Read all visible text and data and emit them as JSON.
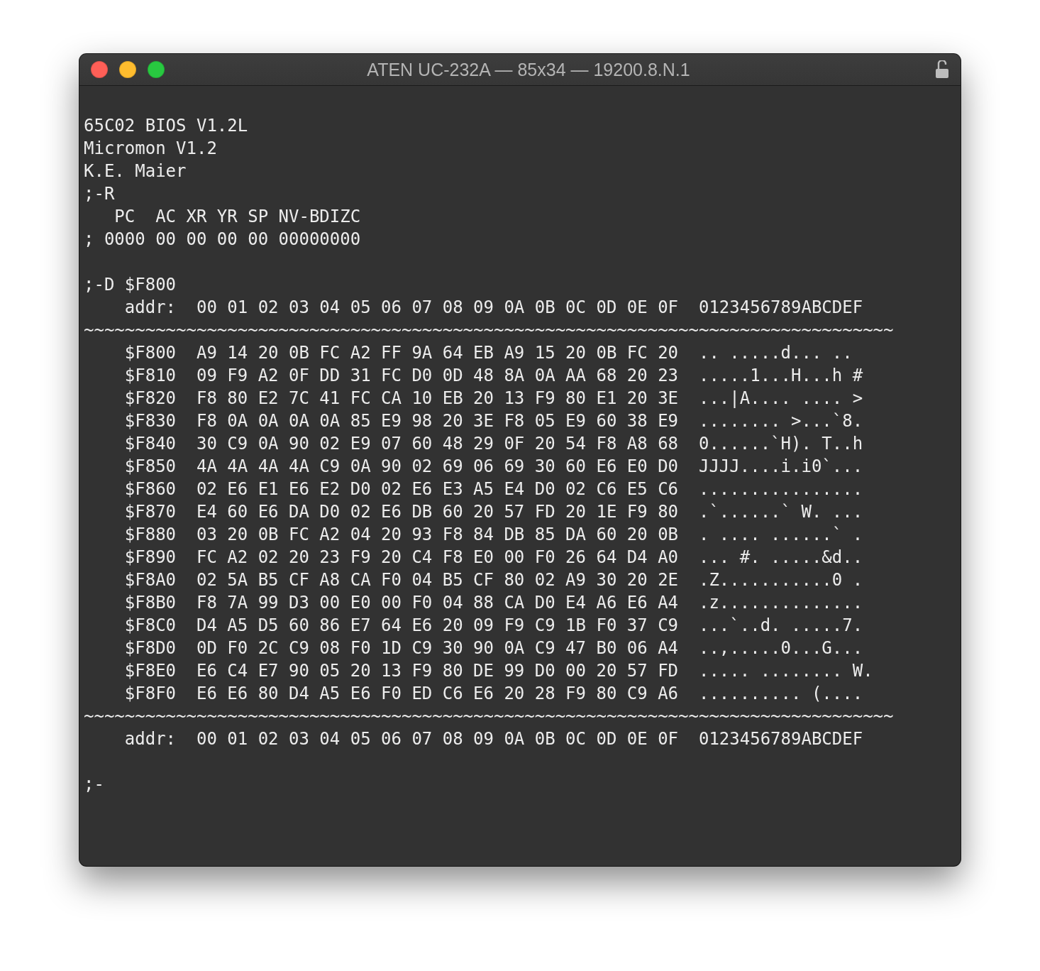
{
  "window": {
    "title": "ATEN UC-232A — 85x34 — 19200.8.N.1",
    "locked": false
  },
  "terminal": {
    "blocks": [
      [
        "65C02 BIOS V1.2L",
        "Micromon V1.2",
        "K.E. Maier",
        ";-R",
        "   PC  AC XR YR SP NV-BDIZC",
        "; 0000 00 00 00 00 00000000"
      ],
      [
        ";-D $F800",
        "    addr:  00 01 02 03 04 05 06 07 08 09 0A 0B 0C 0D 0E 0F  0123456789ABCDEF",
        "~~~~~~~~~~~~~~~~~~~~~~~~~~~~~~~~~~~~~~~~~~~~~~~~~~~~~~~~~~~~~~~~~~~~~~~~~~~~~~~",
        "    $F800  A9 14 20 0B FC A2 FF 9A 64 EB A9 15 20 0B FC 20  .. .....d... ..",
        "    $F810  09 F9 A2 0F DD 31 FC D0 0D 48 8A 0A AA 68 20 23  .....1...H...h #",
        "    $F820  F8 80 E2 7C 41 FC CA 10 EB 20 13 F9 80 E1 20 3E  ...|A.... .... >",
        "    $F830  F8 0A 0A 0A 0A 85 E9 98 20 3E F8 05 E9 60 38 E9  ........ >...`8.",
        "    $F840  30 C9 0A 90 02 E9 07 60 48 29 0F 20 54 F8 A8 68  0......`H). T..h",
        "    $F850  4A 4A 4A 4A C9 0A 90 02 69 06 69 30 60 E6 E0 D0  JJJJ....i.i0`...",
        "    $F860  02 E6 E1 E6 E2 D0 02 E6 E3 A5 E4 D0 02 C6 E5 C6  ................",
        "    $F870  E4 60 E6 DA D0 02 E6 DB 60 20 57 FD 20 1E F9 80  .`......` W. ...",
        "    $F880  03 20 0B FC A2 04 20 93 F8 84 DB 85 DA 60 20 0B  . .... ......` .",
        "    $F890  FC A2 02 20 23 F9 20 C4 F8 E0 00 F0 26 64 D4 A0  ... #. .....&d..",
        "    $F8A0  02 5A B5 CF A8 CA F0 04 B5 CF 80 02 A9 30 20 2E  .Z...........0 .",
        "    $F8B0  F8 7A 99 D3 00 E0 00 F0 04 88 CA D0 E4 A6 E6 A4  .z..............",
        "    $F8C0  D4 A5 D5 60 86 E7 64 E6 20 09 F9 C9 1B F0 37 C9  ...`..d. .....7.",
        "    $F8D0  0D F0 2C C9 08 F0 1D C9 30 90 0A C9 47 B0 06 A4  ..,.....0...G...",
        "    $F8E0  E6 C4 E7 90 05 20 13 F9 80 DE 99 D0 00 20 57 FD  ..... ........ W.",
        "    $F8F0  E6 E6 80 D4 A5 E6 F0 ED C6 E6 20 28 F9 80 C9 A6  .......... (....",
        "~~~~~~~~~~~~~~~~~~~~~~~~~~~~~~~~~~~~~~~~~~~~~~~~~~~~~~~~~~~~~~~~~~~~~~~~~~~~~~~",
        "    addr:  00 01 02 03 04 05 06 07 08 09 0A 0B 0C 0D 0E 0F  0123456789ABCDEF"
      ],
      [
        ";-"
      ]
    ]
  }
}
